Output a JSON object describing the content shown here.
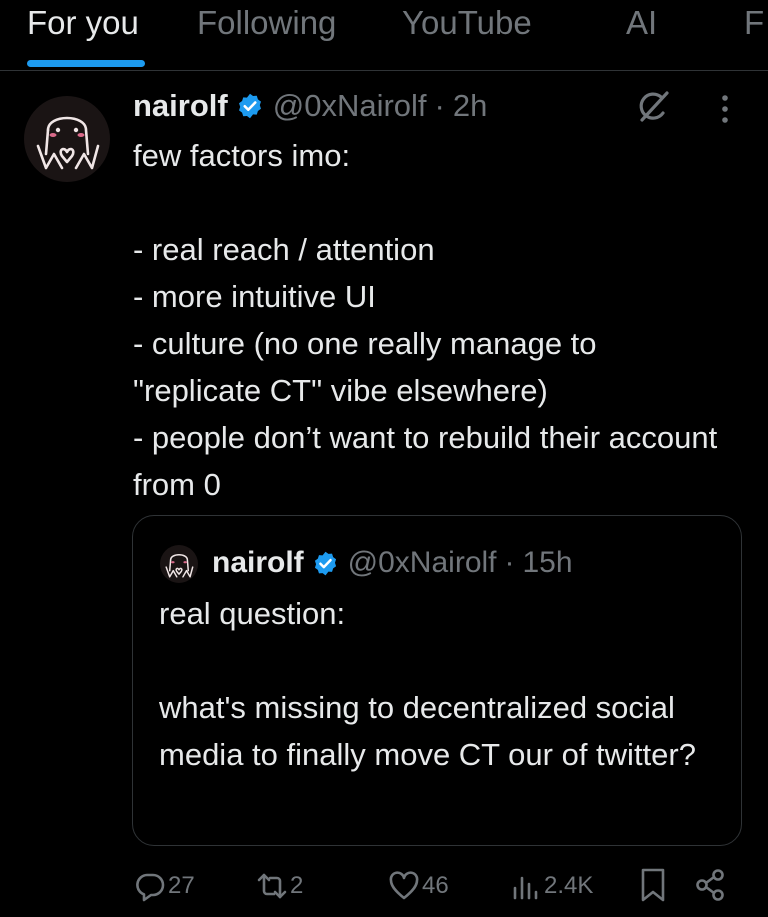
{
  "tabs": [
    {
      "label": "For you",
      "active": true
    },
    {
      "label": "Following",
      "active": false
    },
    {
      "label": "YouTube",
      "active": false
    },
    {
      "label": "AI",
      "active": false
    },
    {
      "label": "F",
      "active": false
    }
  ],
  "tweet": {
    "display_name": "nairolf",
    "handle": "@0xNairolf",
    "separator": "·",
    "time": "2h",
    "text": "few factors imo:\n\n- real reach / attention\n- more intuitive UI\n- culture (no one really manage to \"replicate CT\" vibe elsewhere)\n- people don’t want to rebuild their account from 0",
    "icons": {
      "avatar": "avatar-image",
      "verified": "verified-badge-icon",
      "grok": "grok-icon",
      "more": "more-vertical-icon"
    }
  },
  "quote": {
    "display_name": "nairolf",
    "handle": "@0xNairolf",
    "separator": "·",
    "time": "15h",
    "text": "real question:\n\nwhat's missing to decentralized social media to finally move CT our of twitter?"
  },
  "actions": {
    "replies": "27",
    "reposts": "2",
    "likes": "46",
    "views": "2.4K"
  },
  "colors": {
    "background": "#000000",
    "text": "#e7e9ea",
    "muted": "#71767b",
    "accent": "#1d9bf0",
    "border": "#2f3336"
  }
}
